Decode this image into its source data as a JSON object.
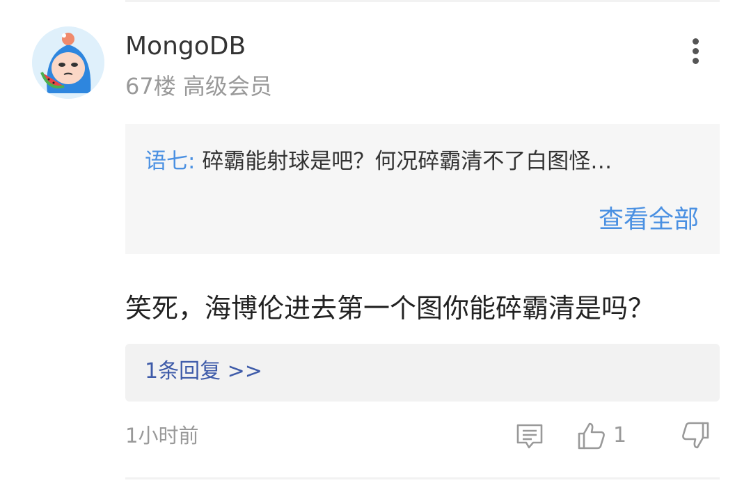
{
  "post": {
    "username": "MongoDB",
    "floor_rank": "67楼 高级会员",
    "quote": {
      "author": "语七:",
      "text": "碎霸能射球是吧？何况碎霸清不了白图怪…",
      "view_all_label": "查看全部"
    },
    "comment_text": "笑死，海博伦进去第一个图你能碎霸清是吗？",
    "reply_link_label": "1条回复 >>",
    "time_ago": "1小时前",
    "like_count": "1"
  },
  "icons": {
    "more": "more-vertical-icon",
    "comment": "comment-icon",
    "like": "thumbs-up-icon",
    "dislike": "thumbs-down-icon"
  },
  "colors": {
    "link_blue": "#4a90e2",
    "reply_blue": "#3e5ba9",
    "muted_gray": "#999999",
    "panel_bg": "#f6f6f6"
  }
}
